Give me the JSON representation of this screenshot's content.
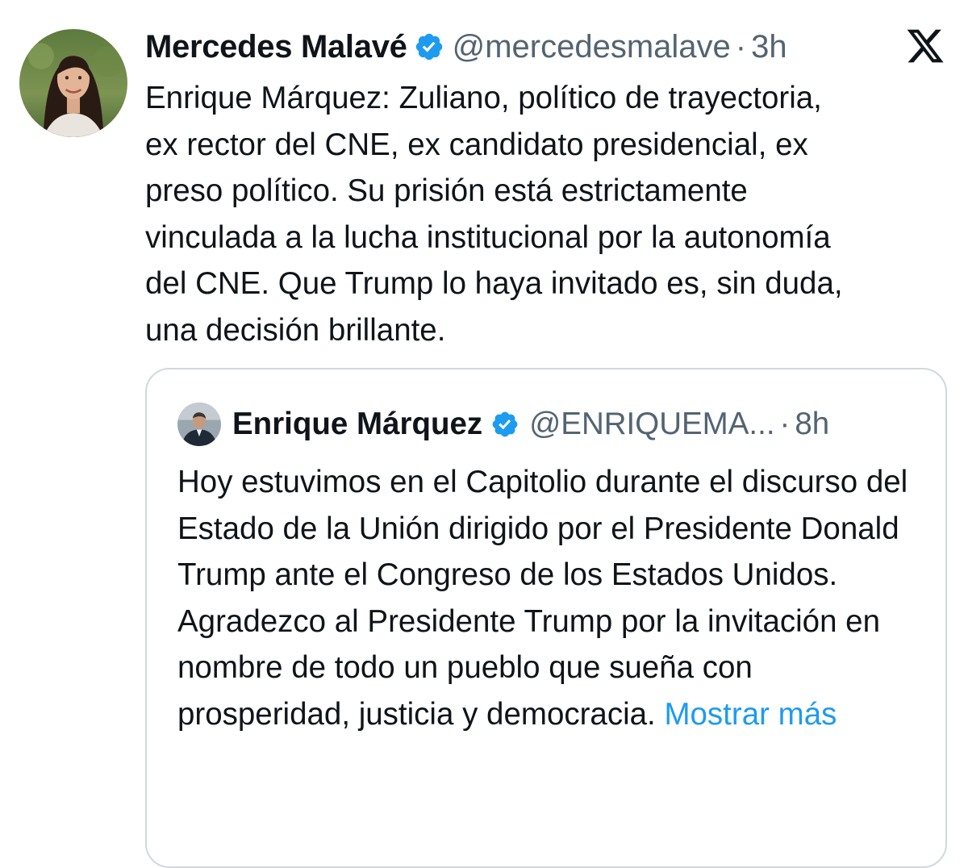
{
  "tweet": {
    "author_name": "Mercedes Malavé",
    "handle": "@mercedesmalave",
    "separator": "·",
    "time": "3h",
    "text": "Enrique Márquez: Zuliano, político de trayectoria,\nex rector del CNE, ex candidato presidencial, ex\npreso político. Su prisión está estrictamente\nvinculada a la lucha institucional por la autonomía\ndel CNE. Que Trump lo haya invitado es, sin duda,\nuna decisión brillante."
  },
  "quoted_tweet": {
    "author_name": "Enrique Márquez",
    "handle": "@ENRIQUEMA...",
    "separator": "·",
    "time": "8h",
    "text": "Hoy estuvimos en el Capitolio durante el discurso del Estado de la Unión dirigido por el Presidente Donald Trump ante el Congreso de los Estados Unidos. Agradezco al Presidente Trump por la invitación en nombre de todo un pueblo que sueña con prosperidad, justicia y democracia. ",
    "show_more_label": "Mostrar más"
  },
  "icons": {
    "brand": "x-logo-icon",
    "verified": "verified-badge-icon"
  },
  "colors": {
    "text_primary": "#0f1419",
    "text_secondary": "#536471",
    "link": "#1d9bf0",
    "verified_badge": "#1d9bf0",
    "card_border": "#cfd9de"
  }
}
